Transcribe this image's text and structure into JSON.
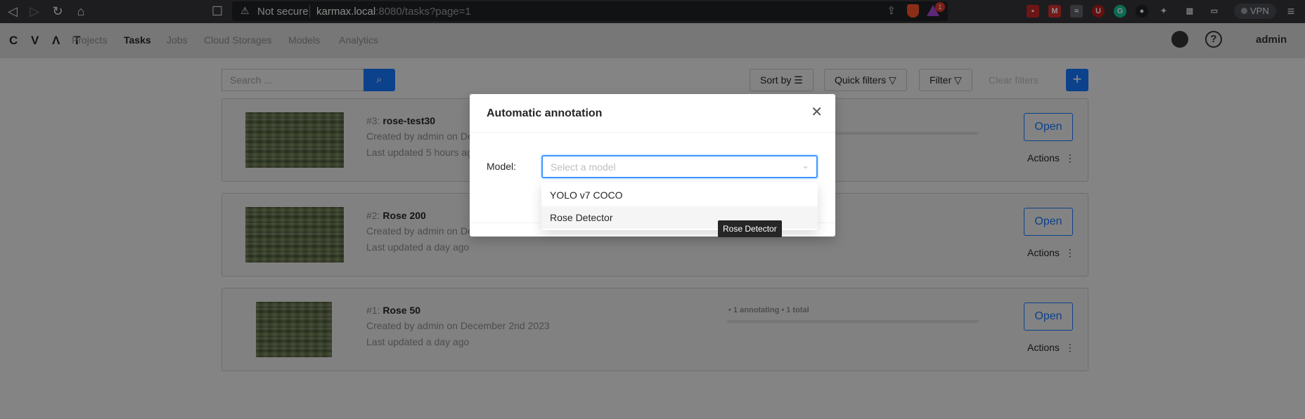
{
  "browser": {
    "security_label": "Not secure",
    "url_host": "karmax.local",
    "url_path": ":8080/tasks?page=1",
    "rewards_count": "1",
    "vpn_label": "VPN"
  },
  "app": {
    "logo": "CVAT",
    "nav": [
      "Projects",
      "Tasks",
      "Jobs",
      "Cloud Storages",
      "Models",
      "Analytics"
    ],
    "active_nav": "Tasks",
    "user": "admin"
  },
  "toolbar": {
    "search_placeholder": "Search ...",
    "sort_by": "Sort by",
    "quick_filters": "Quick filters",
    "filter": "Filter",
    "clear_filters": "Clear filters",
    "add": "+"
  },
  "tasks": [
    {
      "id": "#3:",
      "name": "rose-test30",
      "created": "Created by admin on De",
      "updated": "Last updated 5 hours ago",
      "progress": "",
      "open": "Open",
      "actions": "Actions"
    },
    {
      "id": "#2:",
      "name": "Rose 200",
      "created": "Created by admin on De",
      "updated": "Last updated a day ago",
      "progress": "",
      "open": "Open",
      "actions": "Actions"
    },
    {
      "id": "#1:",
      "name": "Rose 50",
      "created": "Created by admin on December 2nd 2023",
      "updated": "Last updated a day ago",
      "progress": "• 1 annotating • 1 total",
      "open": "Open",
      "actions": "Actions"
    }
  ],
  "modal": {
    "title": "Automatic annotation",
    "model_label": "Model:",
    "select_placeholder": "Select a model",
    "options": [
      "YOLO v7 COCO",
      "Rose Detector"
    ],
    "hovered_option": "Rose Detector",
    "tooltip": "Rose Detector"
  },
  "colors": {
    "primary": "#1677ff",
    "chrome": "#35363a",
    "header": "#d9d9d9"
  }
}
